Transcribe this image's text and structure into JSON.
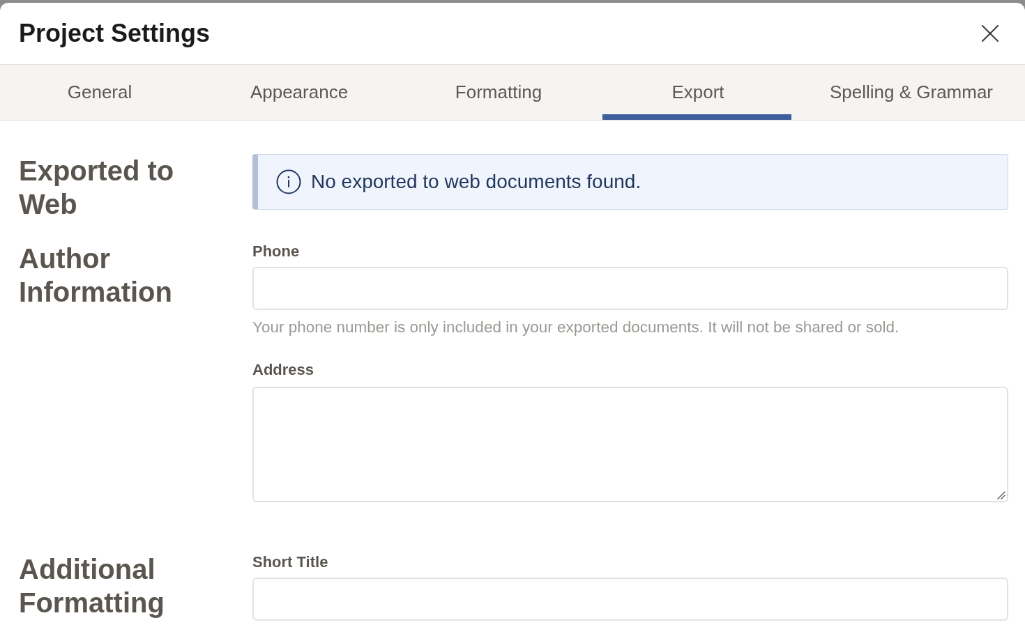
{
  "dialog": {
    "title": "Project Settings"
  },
  "tabs": [
    {
      "label": "General",
      "selected": false
    },
    {
      "label": "Appearance",
      "selected": false
    },
    {
      "label": "Formatting",
      "selected": false
    },
    {
      "label": "Export",
      "selected": true
    },
    {
      "label": "Spelling & Grammar",
      "selected": false
    }
  ],
  "sections": [
    {
      "heading": "Exported to Web",
      "notice": {
        "text": "No exported to web documents found."
      }
    },
    {
      "heading": "Author Information",
      "fields": [
        {
          "label": "Phone",
          "kind": "input",
          "hint": "Your phone number is only included in your exported documents. It will not be shared or sold."
        },
        {
          "label": "Address",
          "kind": "textarea"
        }
      ]
    },
    {
      "heading": "Additional Formatting",
      "fields": [
        {
          "label": "Short Title",
          "kind": "input"
        }
      ]
    }
  ]
}
